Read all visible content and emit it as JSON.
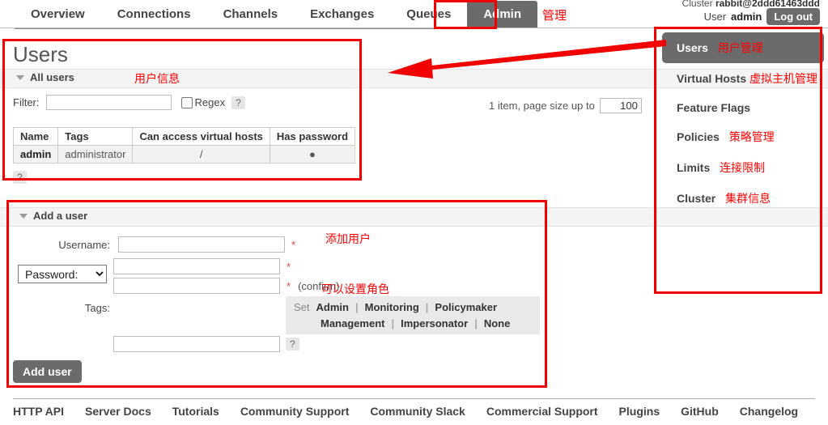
{
  "colors": {
    "accent_red": "#f20000",
    "gray_button": "#6b6b6b",
    "band": "#f4f4f4"
  },
  "topbar": {
    "nav": [
      {
        "label": "Overview",
        "active": false
      },
      {
        "label": "Connections",
        "active": false
      },
      {
        "label": "Channels",
        "active": false
      },
      {
        "label": "Exchanges",
        "active": false
      },
      {
        "label": "Queues",
        "active": false
      },
      {
        "label": "Admin",
        "active": true
      }
    ],
    "nav_annotation": "管理",
    "cluster_prefix": "Cluster",
    "cluster_name": "rabbit@2ddd61463ddd",
    "user_prefix": "User",
    "user_name": "admin",
    "logout_label": "Log out"
  },
  "main": {
    "page_title": "Users",
    "all_users_label": "All users",
    "all_users_annotation": "用户信息",
    "filter": {
      "label": "Filter:",
      "value": "",
      "placeholder": "",
      "regex_label": "Regex",
      "regex_checked": false,
      "help": "?"
    },
    "paging": {
      "summary": "1 item, page size up to",
      "page_size": "100"
    },
    "table": {
      "headers": [
        "Name",
        "Tags",
        "Can access virtual hosts",
        "Has password"
      ],
      "rows": [
        {
          "name": "admin",
          "tags": "administrator",
          "vhosts": "/",
          "has_password": "●"
        }
      ],
      "help": "?"
    },
    "add_user": {
      "section_label": "Add a user",
      "annotation": "添加用户",
      "username_label": "Username:",
      "username_value": "",
      "password_select": "Password:",
      "password_value": "",
      "password_confirm_value": "",
      "confirm_text": "(confirm)",
      "required_mark": "*",
      "tags_label": "Tags:",
      "tags_value": "",
      "tags_help": "?",
      "tags_annotation": "可以设置角色",
      "set_label": "Set",
      "tag_options_row1": [
        "Admin",
        "Monitoring",
        "Policymaker"
      ],
      "tag_options_row2": [
        "Management",
        "Impersonator",
        "None"
      ],
      "submit_label": "Add user"
    }
  },
  "sidebar": {
    "items": [
      {
        "label": "Users",
        "annotation": "用户管理",
        "active": true
      },
      {
        "label": "Virtual Hosts",
        "annotation": "虚拟主机管理",
        "active": false
      },
      {
        "label": "Feature Flags",
        "annotation": "",
        "active": false
      },
      {
        "label": "Policies",
        "annotation": "策略管理",
        "active": false
      },
      {
        "label": "Limits",
        "annotation": "连接限制",
        "active": false
      },
      {
        "label": "Cluster",
        "annotation": "集群信息",
        "active": false
      }
    ]
  },
  "footer": {
    "links": [
      "HTTP API",
      "Server Docs",
      "Tutorials",
      "Community Support",
      "Community Slack",
      "Commercial Support",
      "Plugins",
      "GitHub",
      "Changelog"
    ]
  }
}
